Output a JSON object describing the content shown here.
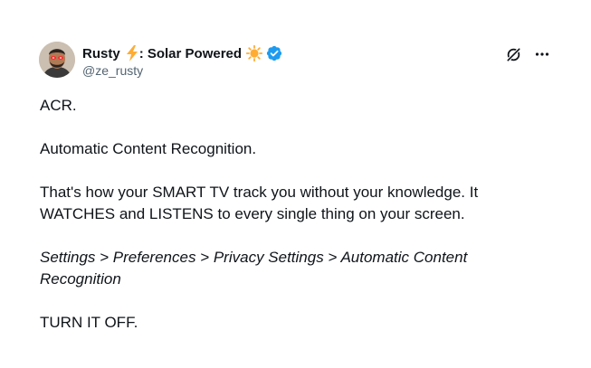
{
  "author": {
    "display_name": "Rusty",
    "name_suffix": ": Solar Powered",
    "handle": "@ze_rusty",
    "verified": true
  },
  "icons": {
    "avatar": "avatar-photo",
    "emoji_1": "lightning-icon",
    "emoji_2": "sun-icon",
    "verified": "verified-badge-icon",
    "grok": "grok-icon",
    "more": "more-icon"
  },
  "tweet": {
    "line_1": "ACR.",
    "line_2": "Automatic Content Recognition.",
    "line_3": "That's how your SMART TV track you without your knowledge. It WATCHES and LISTENS to every single thing on your screen.",
    "line_4": "Settings > Preferences > Privacy Settings > Automatic Content Recognition",
    "line_5": "TURN IT OFF."
  },
  "colors": {
    "text": "#0f1419",
    "secondary": "#536471",
    "verified": "#1d9bf0",
    "lightning": "#ffac33",
    "sun": "#ffac33"
  }
}
